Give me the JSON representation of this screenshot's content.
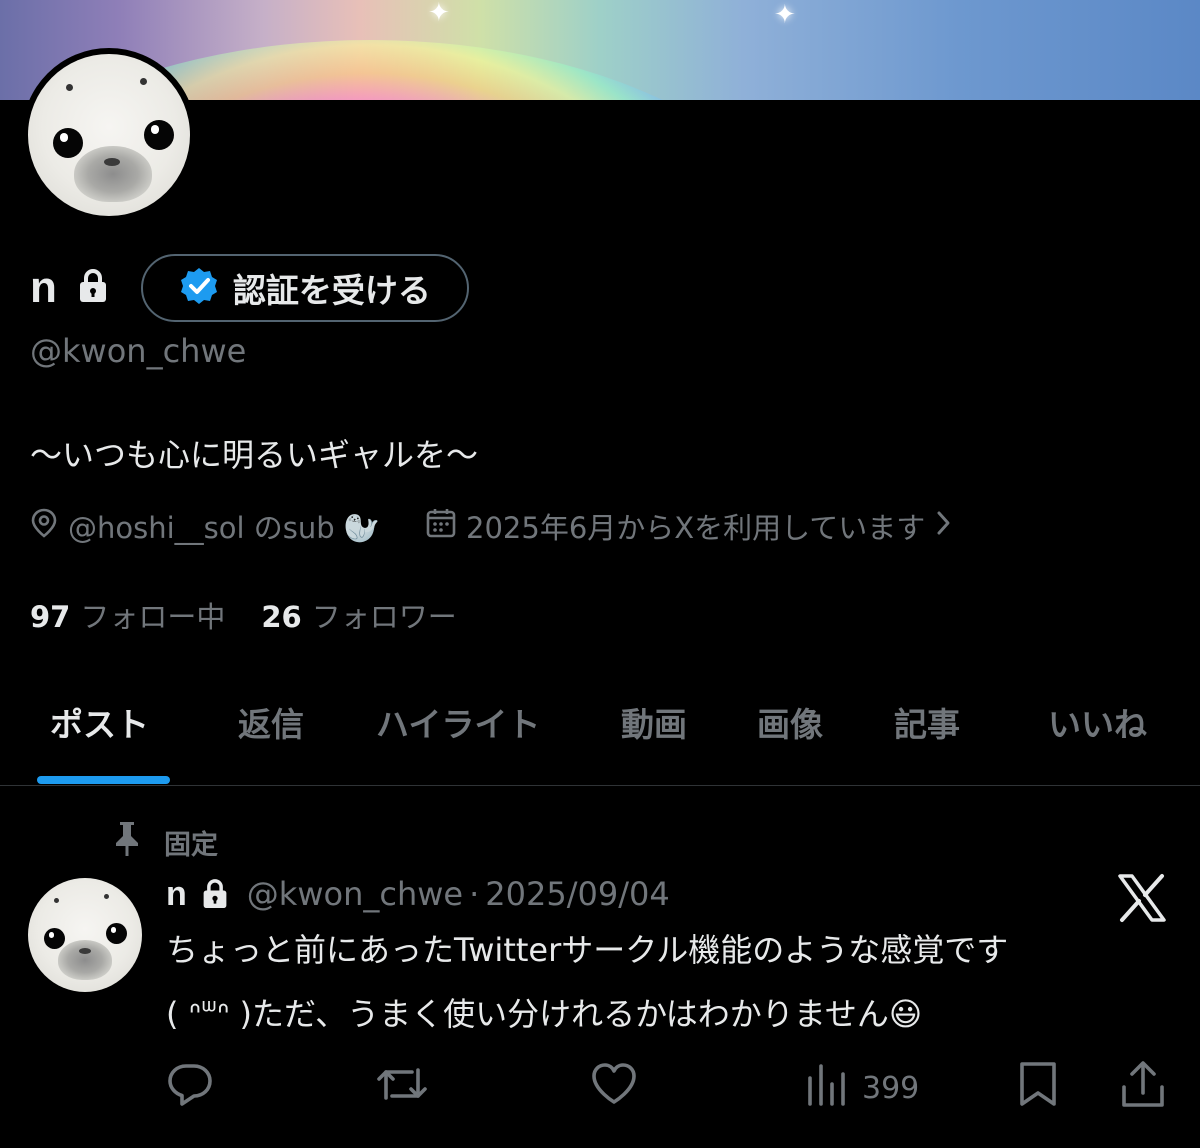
{
  "profile": {
    "display_name": "n",
    "verify_button_label": "認証を受ける",
    "handle": "@kwon_chwe",
    "bio": "〜いつも心に明るいギャルを〜",
    "location": "@hoshi__sol のsub 🦭",
    "joined": "2025年6月からXを利用しています",
    "following_count": "97",
    "following_label": "フォロー中",
    "followers_count": "26",
    "followers_label": "フォロワー"
  },
  "tabs": [
    {
      "label": "ポスト",
      "active": true
    },
    {
      "label": "返信"
    },
    {
      "label": "ハイライト"
    },
    {
      "label": "動画"
    },
    {
      "label": "画像"
    },
    {
      "label": "記事"
    },
    {
      "label": "いいね"
    }
  ],
  "pinned_post": {
    "pinned_label": "固定",
    "author_name": "n",
    "author_handle": "@kwon_chwe",
    "separator": "·",
    "date": "2025/09/04",
    "text_line1": "ちょっと前にあったTwitterサークル機能のような感覚です",
    "text_line2": "( ᐢᐜᐢ )ただ、うまく使い分けれるかはわかりません😃",
    "views": "399"
  },
  "colors": {
    "background": "#000000",
    "text_primary": "#e7e9ea",
    "text_secondary": "#71767b",
    "accent": "#1d9bf0",
    "border": "#2f3336"
  },
  "icons": [
    "lock-icon",
    "verified-badge-icon",
    "location-pin-icon",
    "calendar-icon",
    "chevron-right-icon",
    "pin-icon",
    "x-logo-icon",
    "reply-icon",
    "repost-icon",
    "like-icon",
    "views-icon",
    "bookmark-icon",
    "share-icon"
  ]
}
